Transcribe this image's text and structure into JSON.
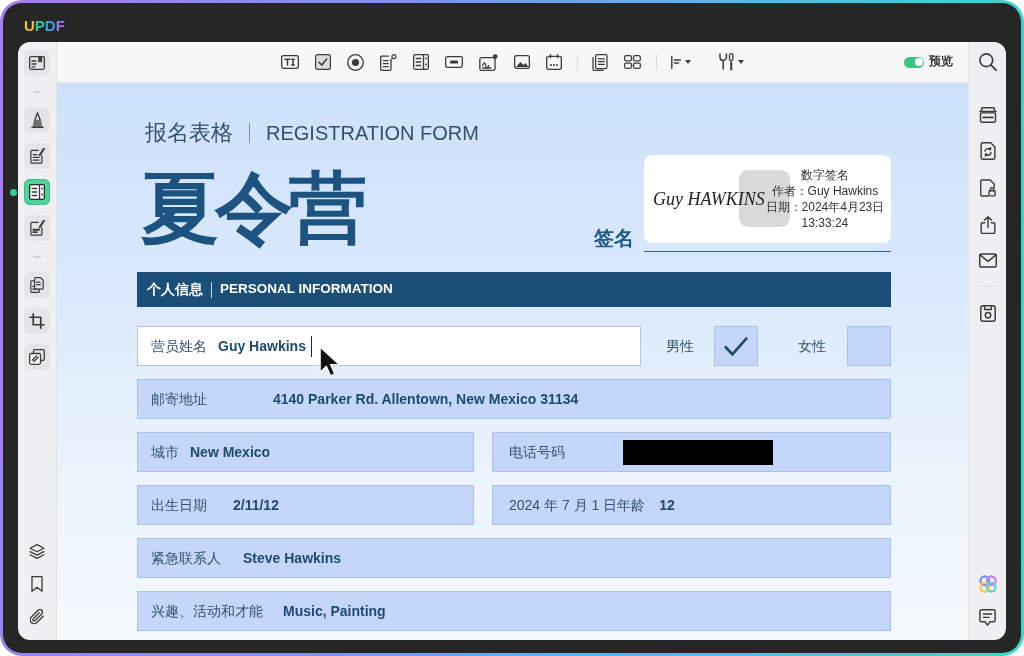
{
  "app": {
    "name": "UPDF"
  },
  "left_toolbar": {
    "groups": [
      [
        {
          "selected": false
        }
      ],
      [
        {
          "selected": false
        },
        {
          "selected": false
        },
        {
          "selected": true
        },
        {
          "selected": false
        }
      ],
      [
        {
          "selected": false
        },
        {
          "selected": false
        },
        {
          "selected": false
        }
      ]
    ]
  },
  "top_toolbar": {
    "preview_toggle": {
      "label": "预览",
      "on": true
    }
  },
  "document": {
    "title": "报名表格",
    "title_en": "REGISTRATION FORM",
    "heading": "夏令营",
    "signature": {
      "label": "签名",
      "handwriting": "Guy HAWKINS",
      "details": [
        "数字签名",
        "作者：Guy Hawkins",
        "日期：2024年4月23日",
        "13:33:24"
      ]
    },
    "section": {
      "title": "个人信息",
      "title_en": "PERSONAL INFORMATION"
    },
    "rows": [
      {
        "kind": "name",
        "fields": [
          {
            "label": "营员姓名",
            "value": "Guy Hawkins",
            "focused": true,
            "redacted": false
          }
        ],
        "options": [
          {
            "label": "男性",
            "checked": true
          },
          {
            "label": "女性",
            "checked": false
          }
        ]
      },
      {
        "kind": "fields",
        "fields": [
          {
            "label": "邮寄地址",
            "value": "4140 Parker Rd. Allentown, New Mexico 31134",
            "focused": false,
            "redacted": false
          }
        ]
      },
      {
        "kind": "fields",
        "fields": [
          {
            "label": "城市",
            "value": "New Mexico",
            "focused": false,
            "redacted": false
          },
          {
            "label": "电话号码",
            "focused": false,
            "redacted": true
          }
        ]
      },
      {
        "kind": "fields",
        "fields": [
          {
            "label": "出生日期",
            "value": "2/11/12",
            "focused": false,
            "redacted": false
          },
          {
            "label": "2024 年 7 月 1 日年龄",
            "value": "12",
            "focused": false,
            "redacted": false
          }
        ]
      },
      {
        "kind": "fields",
        "fields": [
          {
            "label": "紧急联系人",
            "value": "Steve Hawkins",
            "focused": false,
            "redacted": false
          }
        ]
      },
      {
        "kind": "fields",
        "fields": [
          {
            "label": "兴趣、活动和才能",
            "value": "Music, Painting",
            "focused": false,
            "redacted": false
          }
        ]
      }
    ]
  }
}
